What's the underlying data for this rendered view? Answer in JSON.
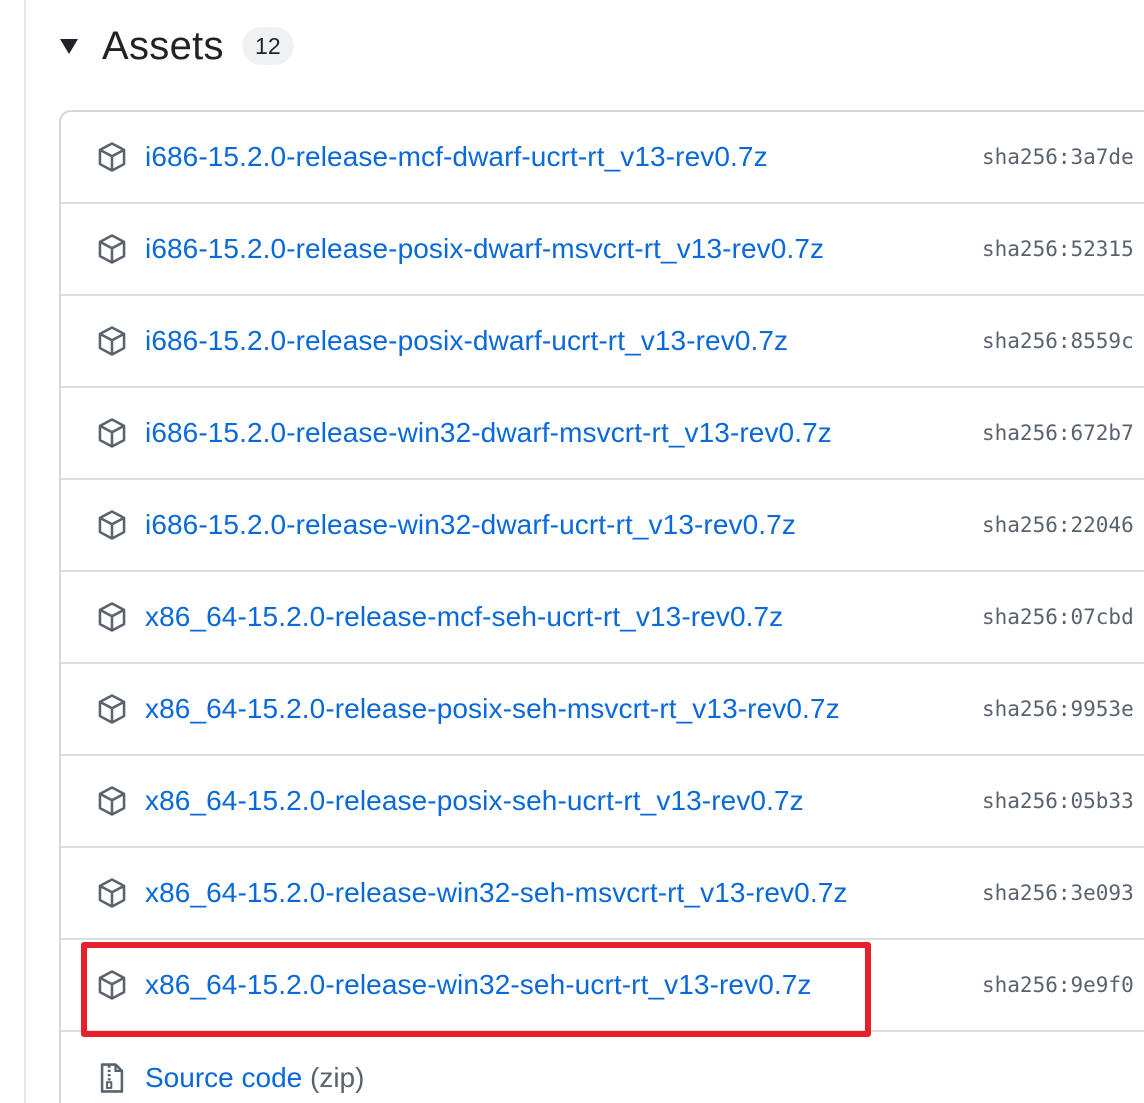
{
  "assets": {
    "title": "Assets",
    "count": "12",
    "items": [
      {
        "name": "i686-15.2.0-release-mcf-dwarf-ucrt-rt_v13-rev0.7z",
        "sha": "sha256:3a7de"
      },
      {
        "name": "i686-15.2.0-release-posix-dwarf-msvcrt-rt_v13-rev0.7z",
        "sha": "sha256:52315"
      },
      {
        "name": "i686-15.2.0-release-posix-dwarf-ucrt-rt_v13-rev0.7z",
        "sha": "sha256:8559c"
      },
      {
        "name": "i686-15.2.0-release-win32-dwarf-msvcrt-rt_v13-rev0.7z",
        "sha": "sha256:672b7"
      },
      {
        "name": "i686-15.2.0-release-win32-dwarf-ucrt-rt_v13-rev0.7z",
        "sha": "sha256:22046"
      },
      {
        "name": "x86_64-15.2.0-release-mcf-seh-ucrt-rt_v13-rev0.7z",
        "sha": "sha256:07cbd"
      },
      {
        "name": "x86_64-15.2.0-release-posix-seh-msvcrt-rt_v13-rev0.7z",
        "sha": "sha256:9953e"
      },
      {
        "name": "x86_64-15.2.0-release-posix-seh-ucrt-rt_v13-rev0.7z",
        "sha": "sha256:05b33"
      },
      {
        "name": "x86_64-15.2.0-release-win32-seh-msvcrt-rt_v13-rev0.7z",
        "sha": "sha256:3e093"
      },
      {
        "name": "x86_64-15.2.0-release-win32-seh-ucrt-rt_v13-rev0.7z",
        "sha": "sha256:9e9f0"
      }
    ],
    "source": {
      "label": "Source code",
      "format": "(zip)"
    }
  },
  "icons": {
    "caret": "triangle-down-icon",
    "asset": "package-icon",
    "source": "file-zip-icon"
  },
  "colors": {
    "link": "#0969da",
    "highlight": "#e8202b",
    "muted": "#59636e"
  }
}
